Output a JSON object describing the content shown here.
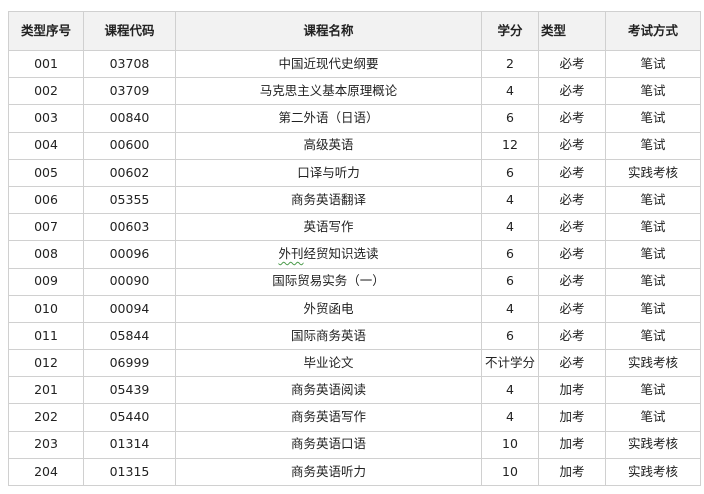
{
  "headers": {
    "type_no": "类型序号",
    "course_code": "课程代码",
    "course_name": "课程名称",
    "credits": "学分",
    "type": "类型",
    "exam_method": "考试方式"
  },
  "rows": [
    {
      "type_no": "001",
      "code": "03708",
      "name": "中国近现代史纲要",
      "credits": "2",
      "type": "必考",
      "exam": "笔试"
    },
    {
      "type_no": "002",
      "code": "03709",
      "name": "马克思主义基本原理概论",
      "credits": "4",
      "type": "必考",
      "exam": "笔试"
    },
    {
      "type_no": "003",
      "code": "00840",
      "name": "第二外语（日语）",
      "credits": "6",
      "type": "必考",
      "exam": "笔试"
    },
    {
      "type_no": "004",
      "code": "00600",
      "name": "高级英语",
      "credits": "12",
      "type": "必考",
      "exam": "笔试"
    },
    {
      "type_no": "005",
      "code": "00602",
      "name": "口译与听力",
      "credits": "6",
      "type": "必考",
      "exam": "实践考核"
    },
    {
      "type_no": "006",
      "code": "05355",
      "name": "商务英语翻译",
      "credits": "4",
      "type": "必考",
      "exam": "笔试"
    },
    {
      "type_no": "007",
      "code": "00603",
      "name": "英语写作",
      "credits": "4",
      "type": "必考",
      "exam": "笔试"
    },
    {
      "type_no": "008",
      "code": "00096",
      "name": "外刊经贸知识选读",
      "credits": "6",
      "type": "必考",
      "exam": "笔试"
    },
    {
      "type_no": "009",
      "code": "00090",
      "name": "国际贸易实务（一）",
      "credits": "6",
      "type": "必考",
      "exam": "笔试"
    },
    {
      "type_no": "010",
      "code": "00094",
      "name": "外贸函电",
      "credits": "4",
      "type": "必考",
      "exam": "笔试"
    },
    {
      "type_no": "011",
      "code": "05844",
      "name": "国际商务英语",
      "credits": "6",
      "type": "必考",
      "exam": "笔试"
    },
    {
      "type_no": "012",
      "code": "06999",
      "name": "毕业论文",
      "credits": "不计学分",
      "type": "必考",
      "exam": "实践考核"
    },
    {
      "type_no": "201",
      "code": "05439",
      "name": "商务英语阅读",
      "credits": "4",
      "type": "加考",
      "exam": "笔试"
    },
    {
      "type_no": "202",
      "code": "05440",
      "name": "商务英语写作",
      "credits": "4",
      "type": "加考",
      "exam": "笔试"
    },
    {
      "type_no": "203",
      "code": "01314",
      "name": "商务英语口语",
      "credits": "10",
      "type": "加考",
      "exam": "实践考核"
    },
    {
      "type_no": "204",
      "code": "01315",
      "name": "商务英语听力",
      "credits": "10",
      "type": "加考",
      "exam": "实践考核"
    }
  ]
}
